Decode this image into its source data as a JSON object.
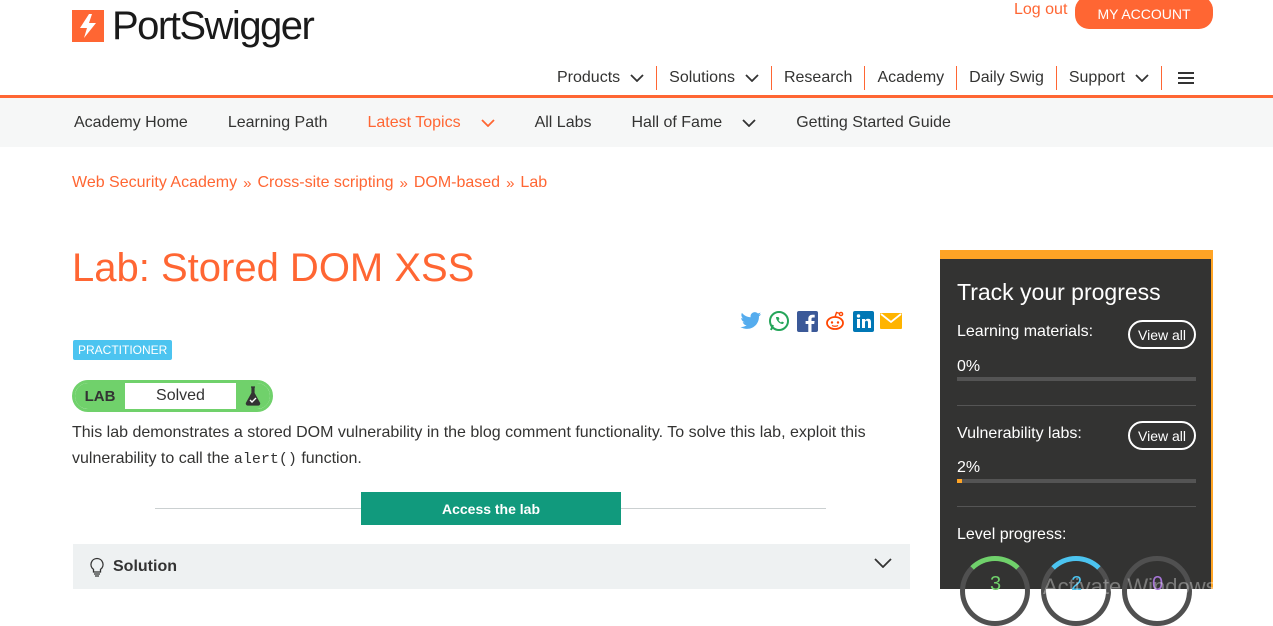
{
  "brand": {
    "name": "PortSwigger",
    "accent": "#ff6633"
  },
  "header": {
    "logout_label": "Log out",
    "account_label": "MY ACCOUNT",
    "nav": [
      {
        "label": "Products",
        "dropdown": true
      },
      {
        "label": "Solutions",
        "dropdown": true
      },
      {
        "label": "Research",
        "dropdown": false
      },
      {
        "label": "Academy",
        "dropdown": false
      },
      {
        "label": "Daily Swig",
        "dropdown": false
      },
      {
        "label": "Support",
        "dropdown": true
      }
    ]
  },
  "subnav": [
    {
      "label": "Academy Home"
    },
    {
      "label": "Learning Path"
    },
    {
      "label": "Latest Topics",
      "active": true,
      "dropdown": true
    },
    {
      "label": "All Labs"
    },
    {
      "label": "Hall of Fame",
      "dropdown": true
    },
    {
      "label": "Getting Started Guide"
    }
  ],
  "breadcrumb": [
    "Web Security Academy",
    "Cross-site scripting",
    "DOM-based",
    "Lab"
  ],
  "page": {
    "title": "Lab: Stored DOM XSS",
    "level_badge": "PRACTITIONER",
    "lab_tag": "LAB",
    "lab_status": "Solved",
    "description_1": "This lab demonstrates a stored DOM vulnerability in the blog comment functionality. To solve this lab, exploit this vulnerability to call the ",
    "description_code": "alert()",
    "description_2": " function.",
    "access_label": "Access the lab",
    "solution_label": "Solution"
  },
  "share_icons": [
    "twitter-icon",
    "whatsapp-icon",
    "facebook-icon",
    "reddit-icon",
    "linkedin-icon",
    "email-icon"
  ],
  "progress": {
    "title": "Track your progress",
    "learning_label": "Learning materials:",
    "learning_pct": "0%",
    "learning_value": 0,
    "labs_label": "Vulnerability labs:",
    "labs_pct": "2%",
    "labs_value": 2,
    "view_all": "View all",
    "level_label": "Level progress:",
    "levels": [
      {
        "value": "3",
        "color": "#70d16b"
      },
      {
        "value": "2",
        "color": "#4cc4f0"
      },
      {
        "value": "0",
        "color": "#a675d6"
      }
    ]
  },
  "watermark": "Activate Windows"
}
